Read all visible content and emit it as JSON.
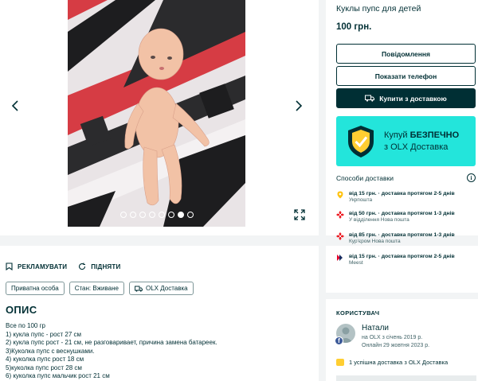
{
  "gallery": {
    "prev_icon": "chevron-left-icon",
    "next_icon": "chevron-right-icon",
    "dot_count": 8,
    "active_dot": 6,
    "expand_icon": "expand-icon"
  },
  "listing": {
    "title": "Куклы пупс для детей",
    "price": "100 грн."
  },
  "buttons": {
    "message": "Повідомлення",
    "show_phone": "Показати телефон",
    "buy_delivery": "Купити з доставкою"
  },
  "banner": {
    "line1_prefix": "Купуй ",
    "line1_bold": "БЕЗПЕЧНО",
    "line2": "з OLX Доставка"
  },
  "delivery": {
    "heading": "Способи доставки",
    "options": [
      {
        "main": "від 15 грн. · доставка протягом 2-5 днів",
        "sub": "Укрпошта",
        "icon": "ukrposhta-icon",
        "color": "#ffc20e"
      },
      {
        "main": "від 50 грн. · доставка протягом 1-3 днів",
        "sub": "У відділення Нова пошта",
        "icon": "nova-poshta-icon",
        "color": "#ed1c24"
      },
      {
        "main": "від 85 грн. · доставка протягом 1-3 днів",
        "sub": "Кур'єром Нова пошта",
        "icon": "nova-poshta-icon",
        "color": "#ed1c24"
      },
      {
        "main": "від 15 грн. · доставка протягом 2-5 днів",
        "sub": "Meest",
        "icon": "meest-icon",
        "color": "#e4002b"
      }
    ]
  },
  "actions": {
    "advertise": "РЕКЛАМУВАТИ",
    "raise": "ПІДНЯТИ"
  },
  "tags": [
    "Приватна особа",
    "Стан: Вживане",
    "OLX Доставка"
  ],
  "description": {
    "title": "ОПИС",
    "lines": [
      "Все по 100 гр",
      "1) кукла пупс - рост 27 см",
      "2) кукла пупс рост - 21 см, не разговаривает, причина замена батареек.",
      "3)Куколка пупс с веснушками.",
      "4) куколка пупс рост 18 см",
      "5)куколка пупс рост 28 см",
      "6) куколка пупс мальчик рост 21 см"
    ]
  },
  "user": {
    "label": "КОРИСТУВАЧ",
    "name": "Натали",
    "since": "на OLX з січень 2019 р.",
    "online": "Онлайн 29 жовтня 2023 р.",
    "badge": "f",
    "deliveries": "1 успішна доставка з OLX Доставка"
  },
  "colors": {
    "primary": "#002f34",
    "banner": "#23e5db",
    "background": "#f2f4f5"
  }
}
